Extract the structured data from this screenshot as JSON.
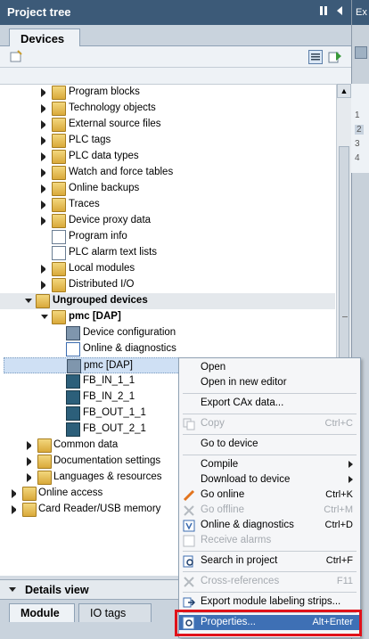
{
  "window": {
    "title": "Project tree",
    "right_panel_label": "Ex"
  },
  "tabs": {
    "devices": "Devices"
  },
  "tree": {
    "items": [
      {
        "label": "Program blocks"
      },
      {
        "label": "Technology objects"
      },
      {
        "label": "External source files"
      },
      {
        "label": "PLC tags"
      },
      {
        "label": "PLC data types"
      },
      {
        "label": "Watch and force tables"
      },
      {
        "label": "Online backups"
      },
      {
        "label": "Traces"
      },
      {
        "label": "Device proxy data"
      },
      {
        "label": "Program info"
      },
      {
        "label": "PLC alarm text lists"
      },
      {
        "label": "Local modules"
      },
      {
        "label": "Distributed I/O"
      },
      {
        "label": "Ungrouped devices"
      },
      {
        "label": "pmc [DAP]"
      },
      {
        "label": "Device configuration"
      },
      {
        "label": "Online & diagnostics"
      },
      {
        "label": "pmc [DAP]"
      },
      {
        "label": "FB_IN_1_1"
      },
      {
        "label": "FB_IN_2_1"
      },
      {
        "label": "FB_OUT_1_1"
      },
      {
        "label": "FB_OUT_2_1"
      },
      {
        "label": "Common data"
      },
      {
        "label": "Documentation settings"
      },
      {
        "label": "Languages & resources"
      },
      {
        "label": "Online access"
      },
      {
        "label": "Card Reader/USB memory"
      }
    ]
  },
  "line_numbers": [
    "1",
    "2",
    "3",
    "4"
  ],
  "context_menu": {
    "items": [
      {
        "label": "Open",
        "shortcut": ""
      },
      {
        "label": "Open in new editor",
        "shortcut": ""
      },
      {
        "label": "Export CAx data...",
        "shortcut": ""
      },
      {
        "label": "Copy",
        "shortcut": "Ctrl+C"
      },
      {
        "label": "Go to device",
        "shortcut": ""
      },
      {
        "label": "Compile",
        "shortcut": ""
      },
      {
        "label": "Download to device",
        "shortcut": ""
      },
      {
        "label": "Go online",
        "shortcut": "Ctrl+K"
      },
      {
        "label": "Go offline",
        "shortcut": "Ctrl+M"
      },
      {
        "label": "Online & diagnostics",
        "shortcut": "Ctrl+D"
      },
      {
        "label": "Receive alarms",
        "shortcut": ""
      },
      {
        "label": "Search in project",
        "shortcut": "Ctrl+F"
      },
      {
        "label": "Cross-references",
        "shortcut": "F11"
      },
      {
        "label": "Export module labeling strips...",
        "shortcut": ""
      },
      {
        "label": "Properties...",
        "shortcut": "Alt+Enter"
      }
    ]
  },
  "details": {
    "title": "Details view",
    "tabs": [
      {
        "label": "Module"
      },
      {
        "label": "IO tags"
      }
    ]
  },
  "colors": {
    "accent": "#3e70b5",
    "highlight_box": "#e0121a",
    "title_bar": "#3c5a78"
  }
}
